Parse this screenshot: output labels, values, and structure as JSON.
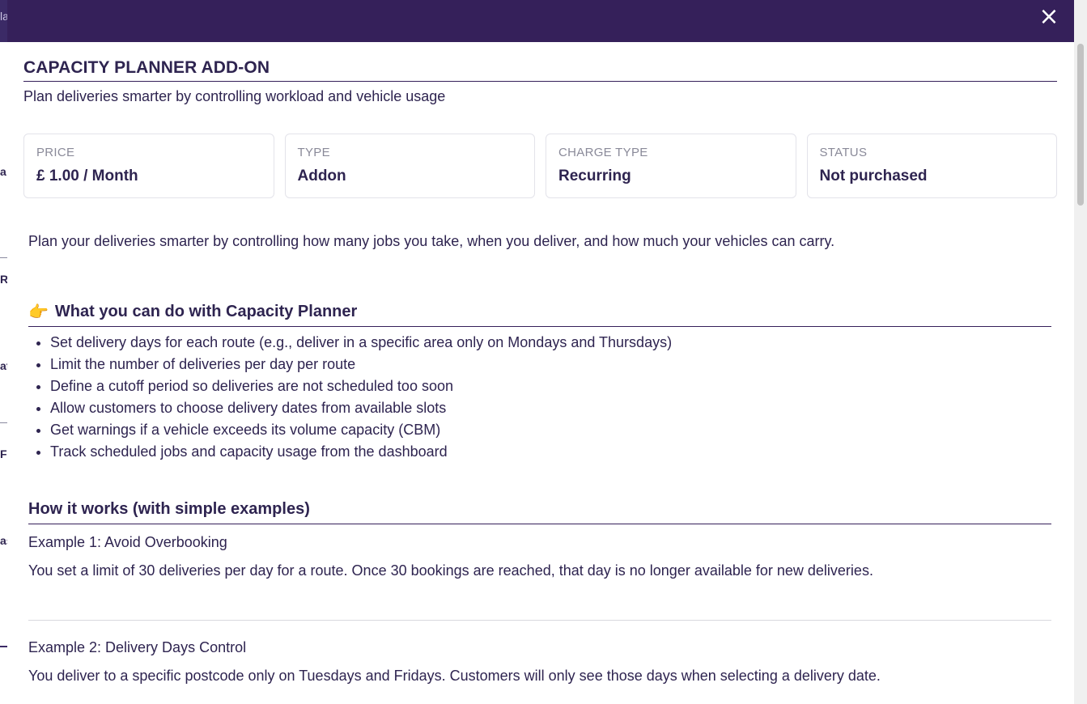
{
  "background": {
    "fragments": [
      "la",
      "a",
      "R",
      "at",
      "F",
      "as"
    ]
  },
  "modal": {
    "close_icon": "×",
    "title": "CAPACITY PLANNER ADD-ON",
    "subtitle": "Plan deliveries smarter by controlling workload and vehicle usage",
    "cards": [
      {
        "label": "PRICE",
        "value": "£ 1.00 / Month"
      },
      {
        "label": "TYPE",
        "value": "Addon"
      },
      {
        "label": "CHARGE TYPE",
        "value": "Recurring"
      },
      {
        "label": "STATUS",
        "value": "Not purchased"
      }
    ],
    "intro": "Plan your deliveries smarter by controlling how many jobs you take, when you deliver, and how much your vehicles can carry.",
    "features_section": {
      "icon": "👉",
      "title": "What you can do with Capacity Planner",
      "items": [
        "Set delivery days for each route (e.g., deliver in a specific area only on Mondays and Thursdays)",
        "Limit the number of deliveries per day per route",
        "Define a cutoff period so deliveries are not scheduled too soon",
        "Allow customers to choose delivery dates from available slots",
        "Get warnings if a vehicle exceeds its volume capacity (CBM)",
        "Track scheduled jobs and capacity usage from the dashboard"
      ]
    },
    "how_section": {
      "title": "How it works (with simple examples)",
      "examples": [
        {
          "title": "Example 1: Avoid Overbooking",
          "text": "You set a limit of 30 deliveries per day for a route. Once 30 bookings are reached, that day is no longer available for new deliveries."
        },
        {
          "title": "Example 2: Delivery Days Control",
          "text": "You deliver to a specific postcode only on Tuesdays and Fridays. Customers will only see those days when selecting a delivery date."
        }
      ]
    }
  },
  "colors": {
    "header": "#35205a",
    "text": "#2e2450",
    "muted": "#8a8a99"
  }
}
